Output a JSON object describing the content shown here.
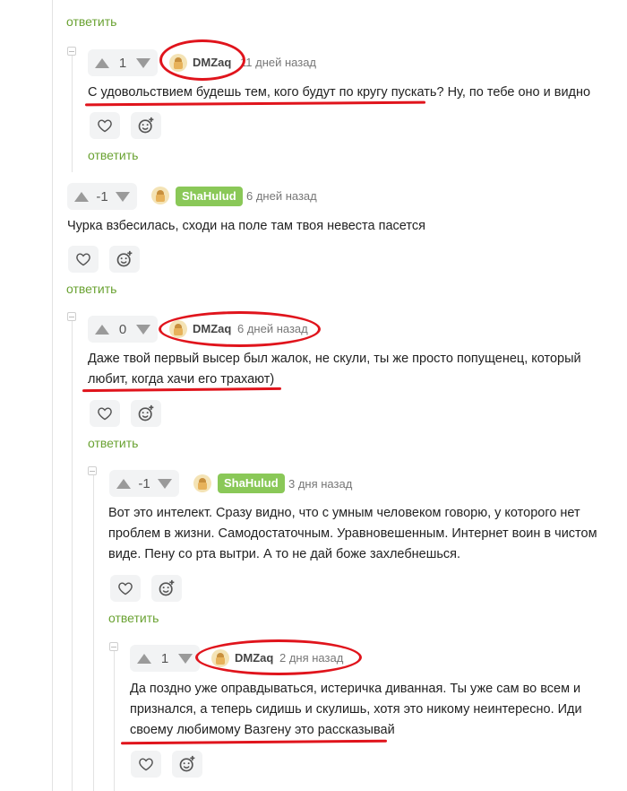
{
  "reply_label": "ответить",
  "colors": {
    "accent": "#6aa232",
    "badge": "#8ac858",
    "highlight": "#e0141c"
  },
  "comments": [
    {
      "score": "1",
      "author": "DMZaq",
      "time": "11 дней назад",
      "lines": [
        "С удовольствием будешь тем, кого будут по кругу пускать? Ну, по тебе оно и видно"
      ]
    },
    {
      "score": "-1",
      "author": "ShaHulud",
      "time": "6 дней назад",
      "lines": [
        "Чурка взбесилась, сходи на поле там твоя невеста пасется"
      ]
    },
    {
      "score": "0",
      "author": "DMZaq",
      "time": "6 дней назад",
      "lines": [
        "Даже твой первый высер был жалок, не скули, ты же просто попущенец, который",
        "любит, когда хачи его трахают)"
      ]
    },
    {
      "score": "-1",
      "author": "ShaHulud",
      "time": "3 дня назад",
      "lines": [
        "Вот это интелект. Сразу видно, что с умным человеком говорю, у которого нет",
        "проблем в жизни. Самодостаточным. Уравновешенным. Интернет воин в чистом",
        "виде. Пену со рта вытри. А то не дай боже захлебнешься."
      ]
    },
    {
      "score": "1",
      "author": "DMZaq",
      "time": "2 дня назад",
      "lines": [
        "Да поздно уже оправдываться, истеричка диванная. Ты уже сам во всем и",
        "признался, а теперь сидишь и скулишь, хотя это никому неинтересно. Иди",
        "своему любимому Вазгену это рассказывай"
      ]
    }
  ]
}
